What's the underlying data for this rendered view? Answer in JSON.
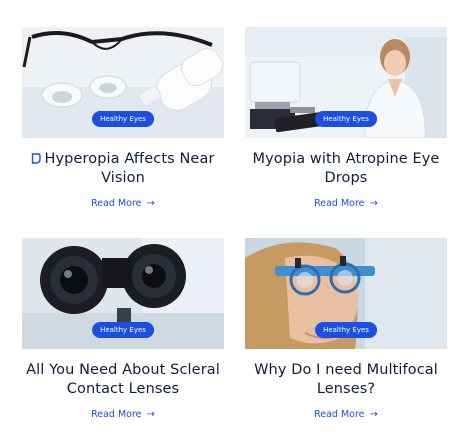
{
  "cards": [
    {
      "badge": "Healthy Eyes",
      "title": "Hyperopia Affects Near Vision",
      "link": "Read More",
      "image": "glasses-and-eye-drops"
    },
    {
      "badge": "Healthy Eyes",
      "title": "Myopia with Atropine Eye Drops",
      "link": "Read More",
      "image": "optometrist-in-clinic"
    },
    {
      "badge": "Healthy Eyes",
      "title": "All You Need About Scleral Contact Lenses",
      "link": "Read More",
      "image": "binocular-eye-device"
    },
    {
      "badge": "Healthy Eyes",
      "title": "Why Do I need Multifocal Lenses?",
      "link": "Read More",
      "image": "woman-in-trial-frame"
    }
  ],
  "icons": {
    "title_prefix": "bookmark-outline-icon",
    "link_arrow": "arrow-right-icon"
  },
  "colors": {
    "accent": "#1a4fe0",
    "heading": "#0f1d3c",
    "badge_text": "#ffffff"
  }
}
